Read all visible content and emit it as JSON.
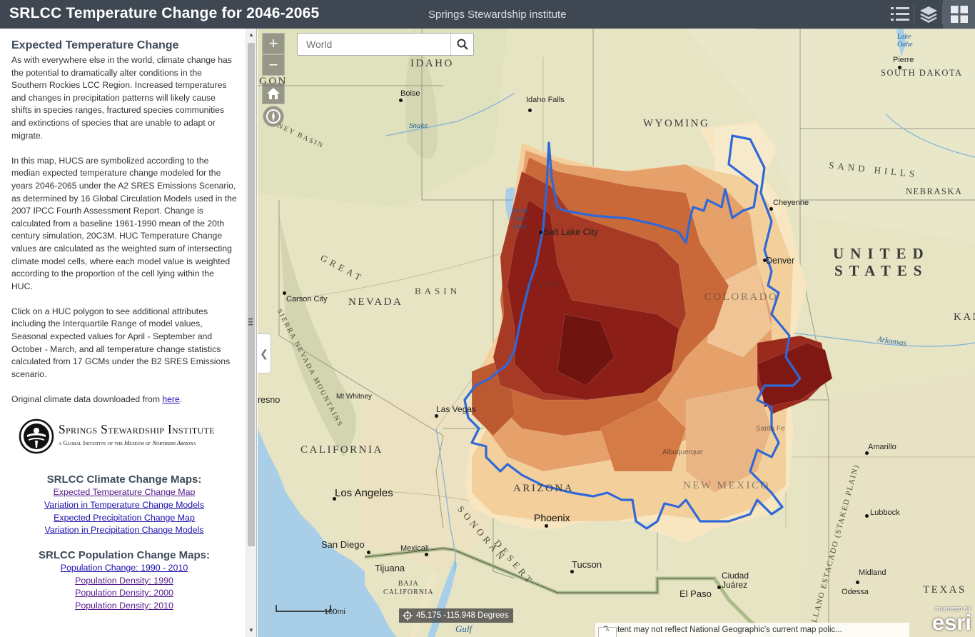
{
  "header": {
    "title": "SRLCC Temperature Change for 2046-2065",
    "subtitle": "Springs Stewardship institute",
    "icons": [
      "legend-list-icon",
      "layers-icon",
      "apps-grid-icon"
    ]
  },
  "panel": {
    "heading": "Expected Temperature Change",
    "para1": "As with everywhere else in the world, climate change has the potential to dramatically alter conditions in the Southern Rockies LCC Region.  Increased temperatures and changes in precipitation patterns will likely cause shifts in species ranges, fractured species communities and extinctions of species that are unable to adapt or migrate.",
    "para2": "In this map, HUCS are symbolized according to the median expected temperature change modeled for the years 2046-2065 under the A2 SRES Emissions Scenario, as determined by 16 Global Circulation Models used in the 2007 IPCC Fourth Assessment Report.  Change is calculated from a baseline 1961-1990 mean of the 20th century simulation, 20C3M.  HUC Temperature Change values are calculated as the weighted sum of intersecting climate model cells, where each model value is weighted according to the proportion of the cell lying within the HUC.",
    "para3": "Click on a HUC polygon to see additional attributes including the Interquartile Range of model values, Seasonal expected values for April - September and October - March, and all temperature change statistics calculated from 17 GCMs under the B2 SRES Emissions scenario.",
    "para4_prefix": "Original climate data downloaded from ",
    "para4_link": "here",
    "para4_suffix": ".",
    "logo_main": "Springs Stewardship Institute",
    "logo_sub_1": "a Global Initiative of the ",
    "logo_sub_2": "Museum of Northern Arizona",
    "climate_title": "SRLCC Climate Change Maps:",
    "climate_links": [
      "Expected Temperature Change Map",
      "Variation in Temperature Change Models",
      "Expected Precipitation Change Map",
      "Variation in Precipitation Change Models"
    ],
    "population_title": "SRLCC Population Change Maps:",
    "population_links": [
      "Population Change: 1990 - 2010",
      "Population Density: 1990",
      "Population Density: 2000",
      "Population Density: 2010"
    ]
  },
  "map": {
    "search_placeholder": "World",
    "zoom_in": "+",
    "zoom_out": "−",
    "scale_label": "100mi",
    "coordinates": "45.175 -115.948 Degrees",
    "attribution": "Content may not reflect National Geographic's current map polic...",
    "attribution_toggle": "^",
    "esri_powered": "POWERED BY",
    "esri_word": "esri",
    "labels": {
      "idaho": "IDAHO",
      "wyoming": "WYOMING",
      "south_dakota": "SOUTH DAKOTA",
      "nebraska": "NEBRASKA",
      "nevada": "NEVADA",
      "california": "CALIFORNIA",
      "arizona": "ARIZONA",
      "new_mexico": "NEW MEXICO",
      "colorado": "COLORADO",
      "utah": "UTAH",
      "texas": "TEXAS",
      "kan": "KAN",
      "oregon": "GON",
      "baja": "BAJA\nCALIFORNIA",
      "united": "UNITED",
      "states": "STATES",
      "great_basin_1": "GREAT",
      "great_basin_2": "BASIN",
      "sand_hills": "SAND HILLS",
      "sonoran_1": "SONORAN",
      "sonoran_2": "DESERT",
      "llano": "LLANO ESTACADO (STAKED PLAIN)",
      "sierra": "SIERRA NEVADA MOUNTAINS",
      "snake": "Snake",
      "arkansas": "Arkansas",
      "gulf": "Gulf",
      "great_salt_lake": "Great\nSalt\nLake",
      "lake_oahe": "Lake\nOahe",
      "boise": "Boise",
      "idaho_falls": "Idaho Falls",
      "pierre": "Pierre",
      "cheyenne": "Cheyenne",
      "salt_lake_city": "Salt Lake City",
      "denver": "Denver",
      "carson_city": "Carson City",
      "fresno": "resno",
      "mt_whitney": "Mt Whitney",
      "las_vegas": "Las Vegas",
      "santa_fe": "Santa Fe",
      "albuquerque": "Albuquerque",
      "amarillo": "Amarillo",
      "lubbock": "Lubbock",
      "midland": "Midland",
      "odessa": "Odessa",
      "los_angeles": "Los Angeles",
      "phoenix": "Phoenix",
      "san_diego": "San Diego",
      "tijuana": "Tijuana",
      "mexicali": "Mexicali",
      "tucson": "Tucson",
      "el_paso": "El Paso",
      "ciudad_juarez": "Ciudad\nJuárez",
      "basin_label": "NEY BASIN"
    }
  },
  "colors": {
    "header_bg": "#3f4852",
    "water": "#a9cfe8",
    "land": "#e6e4c2",
    "boundary_line": "#2f68d8",
    "huc_darkest": "#8b1e16",
    "huc_dark": "#a63a24",
    "huc_mid": "#c9693a",
    "huc_light": "#e6a06a",
    "huc_pale": "#f3cf9c",
    "huc_palest": "#f8e6c0"
  }
}
